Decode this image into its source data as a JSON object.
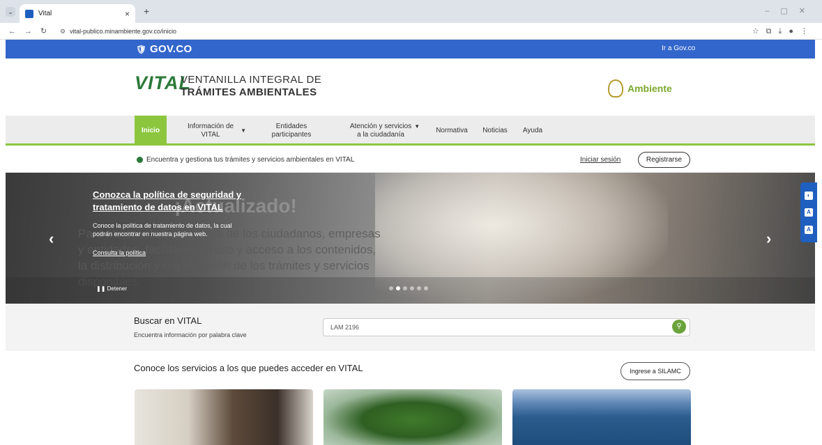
{
  "browser": {
    "tab_title": "Vital",
    "tab_close": "×",
    "new_tab": "+",
    "url": "vital-publico.minambiente.gov.co/inicio"
  },
  "gov": {
    "logo": "GOV.CO",
    "link": "Ir a Gov.co"
  },
  "header": {
    "vital": "VITAL",
    "tagline_1": "VENTANILLA INTEGRAL DE",
    "tagline_2": "TRÁMITES AMBIENTALES",
    "ministry": "Ambiente"
  },
  "nav": {
    "inicio": "Inicio",
    "info_vital_1": "Información de",
    "info_vital_2": "VITAL",
    "entidades_1": "Entidades",
    "entidades_2": "participantes",
    "atencion_1": "Atención y servicios",
    "atencion_2": "a la ciudadanía",
    "normativa": "Normativa",
    "noticias": "Noticias",
    "ayuda": "Ayuda"
  },
  "info": {
    "text": "Encuentra y gestiona tus trámites y servicios ambientales en VITAL",
    "login": "Iniciar sesión",
    "register": "Registrarse"
  },
  "hero": {
    "bg_title": "¡Actualizado!",
    "bg_text": "Para mejorar la experiencia de los ciudadanos, empresas y entidades, facilitando el uso y acceso a los contenidos, la distribución y organización de los trámites y servicios disponibles.",
    "title": "Conozca la política de seguridad y tratamiento de datos en VITAL",
    "desc": "Conoce la política de tratamiento de datos, la cual podrán encontrar en nuestra página web.",
    "link": "Consulta la política",
    "stop": "Detener",
    "slides_total": 6,
    "slide_active": 2
  },
  "search": {
    "title": "Buscar en VITAL",
    "subtitle": "Encuentra información por palabra clave",
    "value": "LAM 2196"
  },
  "services": {
    "title": "Conoce los servicios a los que puedes acceder en VITAL",
    "silamc": "Ingrese a SILAMC"
  },
  "colors": {
    "gov_blue": "#3366cc",
    "vital_green": "#8cc63f",
    "access_blue": "#1f5fbf"
  }
}
